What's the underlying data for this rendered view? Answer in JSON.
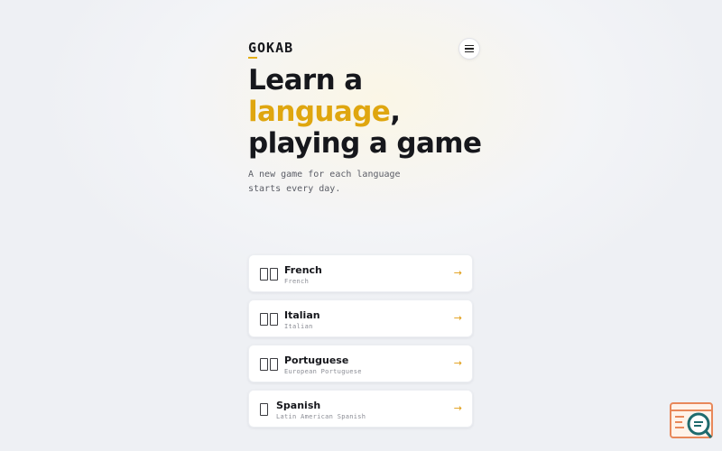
{
  "header": {
    "logo": "GOKAB",
    "menu_icon": "hamburger-menu-icon"
  },
  "hero": {
    "line1": "Learn a",
    "accent_word": "language",
    "comma": ",",
    "line3": "playing a game",
    "subtitle": "A new game for each language starts every day."
  },
  "languages": [
    {
      "name": "French",
      "subtitle": "French",
      "flag_count": 2,
      "arrow": "→"
    },
    {
      "name": "Italian",
      "subtitle": "Italian",
      "flag_count": 2,
      "arrow": "→"
    },
    {
      "name": "Portuguese",
      "subtitle": "European Portuguese",
      "flag_count": 2,
      "arrow": "→"
    },
    {
      "name": "Spanish",
      "subtitle": "Latin American Spanish",
      "flag_count": 1,
      "arrow": "→"
    }
  ],
  "colors": {
    "accent": "#dfa60f",
    "text": "#16171c",
    "badge_orange": "#e8885a",
    "badge_teal": "#1f6b6e"
  },
  "corner_badge": {
    "icon": "search-chat-badge-icon"
  }
}
